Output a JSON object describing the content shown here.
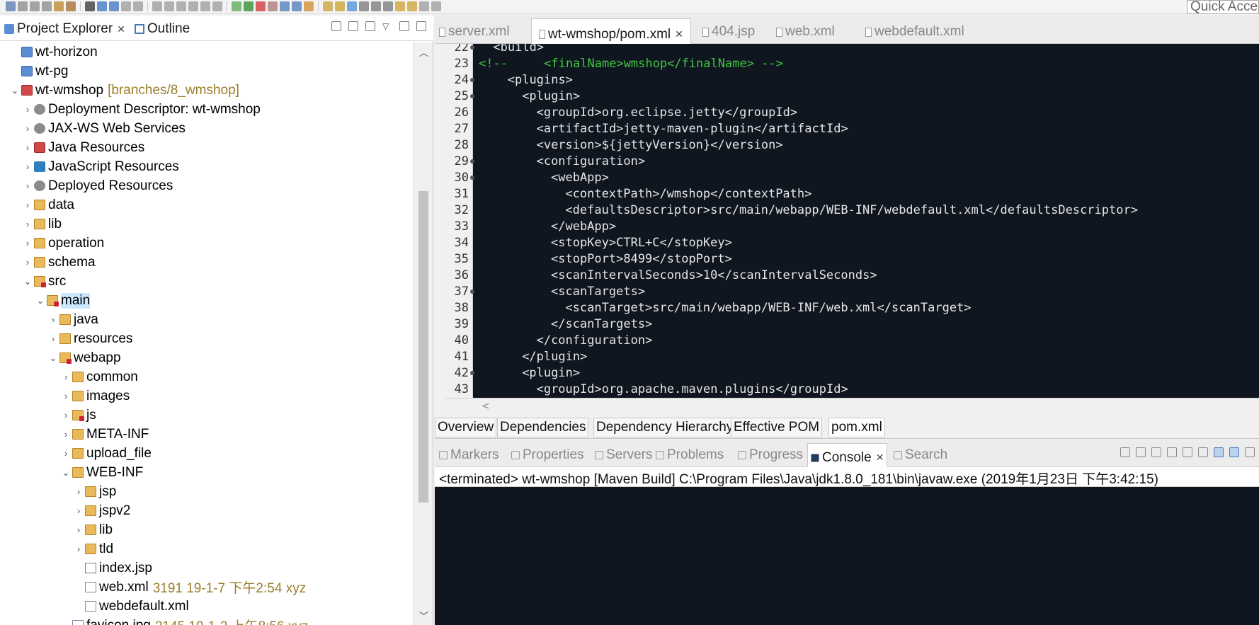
{
  "toolbar": {
    "quick_access": "Quick Access"
  },
  "left_panel": {
    "tabs": [
      {
        "label": "Project Explorer",
        "active": true
      },
      {
        "label": "Outline",
        "active": false
      }
    ],
    "tree": [
      {
        "label": "wt-horizon",
        "indent": 0,
        "arrow": "",
        "icon": "project-icon"
      },
      {
        "label": "wt-pg",
        "indent": 0,
        "arrow": "",
        "icon": "project-icon"
      },
      {
        "label": "wt-wmshop",
        "decoration": "[branches/8_wmshop]",
        "indent": 0,
        "arrow": "v",
        "icon": "web-project-icon"
      },
      {
        "label": "Deployment Descriptor: wt-wmshop",
        "indent": 1,
        "arrow": ">",
        "icon": "deployment-descriptor-icon"
      },
      {
        "label": "JAX-WS Web Services",
        "indent": 1,
        "arrow": ">",
        "icon": "web-services-icon"
      },
      {
        "label": "Java Resources",
        "indent": 1,
        "arrow": ">",
        "icon": "java-resources-icon"
      },
      {
        "label": "JavaScript Resources",
        "indent": 1,
        "arrow": ">",
        "icon": "javascript-resources-icon"
      },
      {
        "label": "Deployed Resources",
        "indent": 1,
        "arrow": ">",
        "icon": "deployed-resources-icon"
      },
      {
        "label": "data",
        "indent": 1,
        "arrow": ">",
        "icon": "folder-icon"
      },
      {
        "label": "lib",
        "indent": 1,
        "arrow": ">",
        "icon": "folder-icon"
      },
      {
        "label": "operation",
        "indent": 1,
        "arrow": ">",
        "icon": "folder-icon"
      },
      {
        "label": "schema",
        "indent": 1,
        "arrow": ">",
        "icon": "folder-icon"
      },
      {
        "label": "src",
        "indent": 1,
        "arrow": "v",
        "icon": "source-folder-icon"
      },
      {
        "label": "main",
        "indent": 2,
        "arrow": "v",
        "icon": "source-folder-icon",
        "selected": true
      },
      {
        "label": "java",
        "indent": 3,
        "arrow": ">",
        "icon": "folder-icon"
      },
      {
        "label": "resources",
        "indent": 3,
        "arrow": ">",
        "icon": "folder-icon"
      },
      {
        "label": "webapp",
        "indent": 3,
        "arrow": "v",
        "icon": "source-folder-icon"
      },
      {
        "label": "common",
        "indent": 4,
        "arrow": ">",
        "icon": "folder-icon"
      },
      {
        "label": "images",
        "indent": 4,
        "arrow": ">",
        "icon": "folder-icon"
      },
      {
        "label": "js",
        "indent": 4,
        "arrow": ">",
        "icon": "source-folder-icon"
      },
      {
        "label": "META-INF",
        "indent": 4,
        "arrow": ">",
        "icon": "folder-icon"
      },
      {
        "label": "upload_file",
        "indent": 4,
        "arrow": ">",
        "icon": "folder-icon"
      },
      {
        "label": "WEB-INF",
        "indent": 4,
        "arrow": "v",
        "icon": "folder-icon"
      },
      {
        "label": "jsp",
        "indent": 5,
        "arrow": ">",
        "icon": "folder-icon"
      },
      {
        "label": "jspv2",
        "indent": 5,
        "arrow": ">",
        "icon": "folder-icon"
      },
      {
        "label": "lib",
        "indent": 5,
        "arrow": ">",
        "icon": "folder-icon"
      },
      {
        "label": "tld",
        "indent": 5,
        "arrow": ">",
        "icon": "folder-icon"
      },
      {
        "label": "index.jsp",
        "indent": 5,
        "arrow": "",
        "icon": "jsp-file-icon"
      },
      {
        "label": "web.xml",
        "decoration": "3191  19-1-7 下午2:54  xyz",
        "indent": 5,
        "arrow": "",
        "icon": "xml-file-icon"
      },
      {
        "label": "webdefault.xml",
        "indent": 5,
        "arrow": "",
        "icon": "xml-file-icon"
      },
      {
        "label": "favicon.jpg",
        "decoration": "2145  19-1-2 上午8:56  xyz",
        "indent": 4,
        "arrow": "",
        "icon": "image-file-icon"
      }
    ]
  },
  "editor": {
    "tabs": [
      {
        "label": "server.xml",
        "active": false
      },
      {
        "label": "wt-wmshop/pom.xml",
        "active": true
      },
      {
        "label": "404.jsp",
        "active": false
      },
      {
        "label": "web.xml",
        "active": false
      },
      {
        "label": "webdefault.xml",
        "active": false
      }
    ],
    "lines": [
      {
        "n": "22",
        "fold": true,
        "indent": 2,
        "text": "<build>",
        "comment": false
      },
      {
        "n": "23",
        "fold": false,
        "indent": 0,
        "text": "<!--     <finalName>wmshop</finalName> -->",
        "comment": true
      },
      {
        "n": "24",
        "fold": true,
        "indent": 4,
        "text": "<plugins>",
        "comment": false
      },
      {
        "n": "25",
        "fold": true,
        "indent": 6,
        "text": "<plugin>",
        "comment": false
      },
      {
        "n": "26",
        "fold": false,
        "indent": 8,
        "text": "<groupId>org.eclipse.jetty</groupId>",
        "comment": false
      },
      {
        "n": "27",
        "fold": false,
        "indent": 8,
        "text": "<artifactId>jetty-maven-plugin</artifactId>",
        "comment": false
      },
      {
        "n": "28",
        "fold": false,
        "indent": 8,
        "text": "<version>${jettyVersion}</version>",
        "comment": false
      },
      {
        "n": "29",
        "fold": true,
        "indent": 8,
        "text": "<configuration>",
        "comment": false
      },
      {
        "n": "30",
        "fold": true,
        "indent": 10,
        "text": "<webApp>",
        "comment": false
      },
      {
        "n": "31",
        "fold": false,
        "indent": 12,
        "text": "<contextPath>/wmshop</contextPath>",
        "comment": false
      },
      {
        "n": "32",
        "fold": false,
        "indent": 12,
        "text": "<defaultsDescriptor>src/main/webapp/WEB-INF/webdefault.xml</defaultsDescriptor>",
        "comment": false
      },
      {
        "n": "33",
        "fold": false,
        "indent": 10,
        "text": "</webApp>",
        "comment": false
      },
      {
        "n": "34",
        "fold": false,
        "indent": 10,
        "text": "<stopKey>CTRL+C</stopKey>",
        "comment": false
      },
      {
        "n": "35",
        "fold": false,
        "indent": 10,
        "text": "<stopPort>8499</stopPort>",
        "comment": false
      },
      {
        "n": "36",
        "fold": false,
        "indent": 10,
        "text": "<scanIntervalSeconds>10</scanIntervalSeconds>",
        "comment": false
      },
      {
        "n": "37",
        "fold": true,
        "indent": 10,
        "text": "<scanTargets>",
        "comment": false
      },
      {
        "n": "38",
        "fold": false,
        "indent": 12,
        "text": "<scanTarget>src/main/webapp/WEB-INF/web.xml</scanTarget>",
        "comment": false
      },
      {
        "n": "39",
        "fold": false,
        "indent": 10,
        "text": "</scanTargets>",
        "comment": false
      },
      {
        "n": "40",
        "fold": false,
        "indent": 8,
        "text": "</configuration>",
        "comment": false
      },
      {
        "n": "41",
        "fold": false,
        "indent": 6,
        "text": "</plugin>",
        "comment": false
      },
      {
        "n": "42",
        "fold": true,
        "indent": 6,
        "text": "<plugin>",
        "comment": false
      },
      {
        "n": "43",
        "fold": false,
        "indent": 8,
        "text": "<groupId>org.apache.maven.plugins</groupId>",
        "comment": false
      }
    ],
    "pom_tabs": [
      {
        "label": "Overview",
        "active": false
      },
      {
        "label": "Dependencies",
        "active": false
      },
      {
        "label": "Dependency Hierarchy",
        "active": false
      },
      {
        "label": "Effective POM",
        "active": false
      },
      {
        "label": "pom.xml",
        "active": true
      }
    ]
  },
  "console": {
    "tabs": [
      {
        "label": "Markers",
        "active": false
      },
      {
        "label": "Properties",
        "active": false
      },
      {
        "label": "Servers",
        "active": false
      },
      {
        "label": "Problems",
        "active": false
      },
      {
        "label": "Progress",
        "active": false
      },
      {
        "label": "Console",
        "active": true
      },
      {
        "label": "Search",
        "active": false
      }
    ],
    "status": "<terminated> wt-wmshop [Maven Build] C:\\Program Files\\Java\\jdk1.8.0_181\\bin\\javaw.exe (2019年1月23日 下午3:42:15)"
  }
}
